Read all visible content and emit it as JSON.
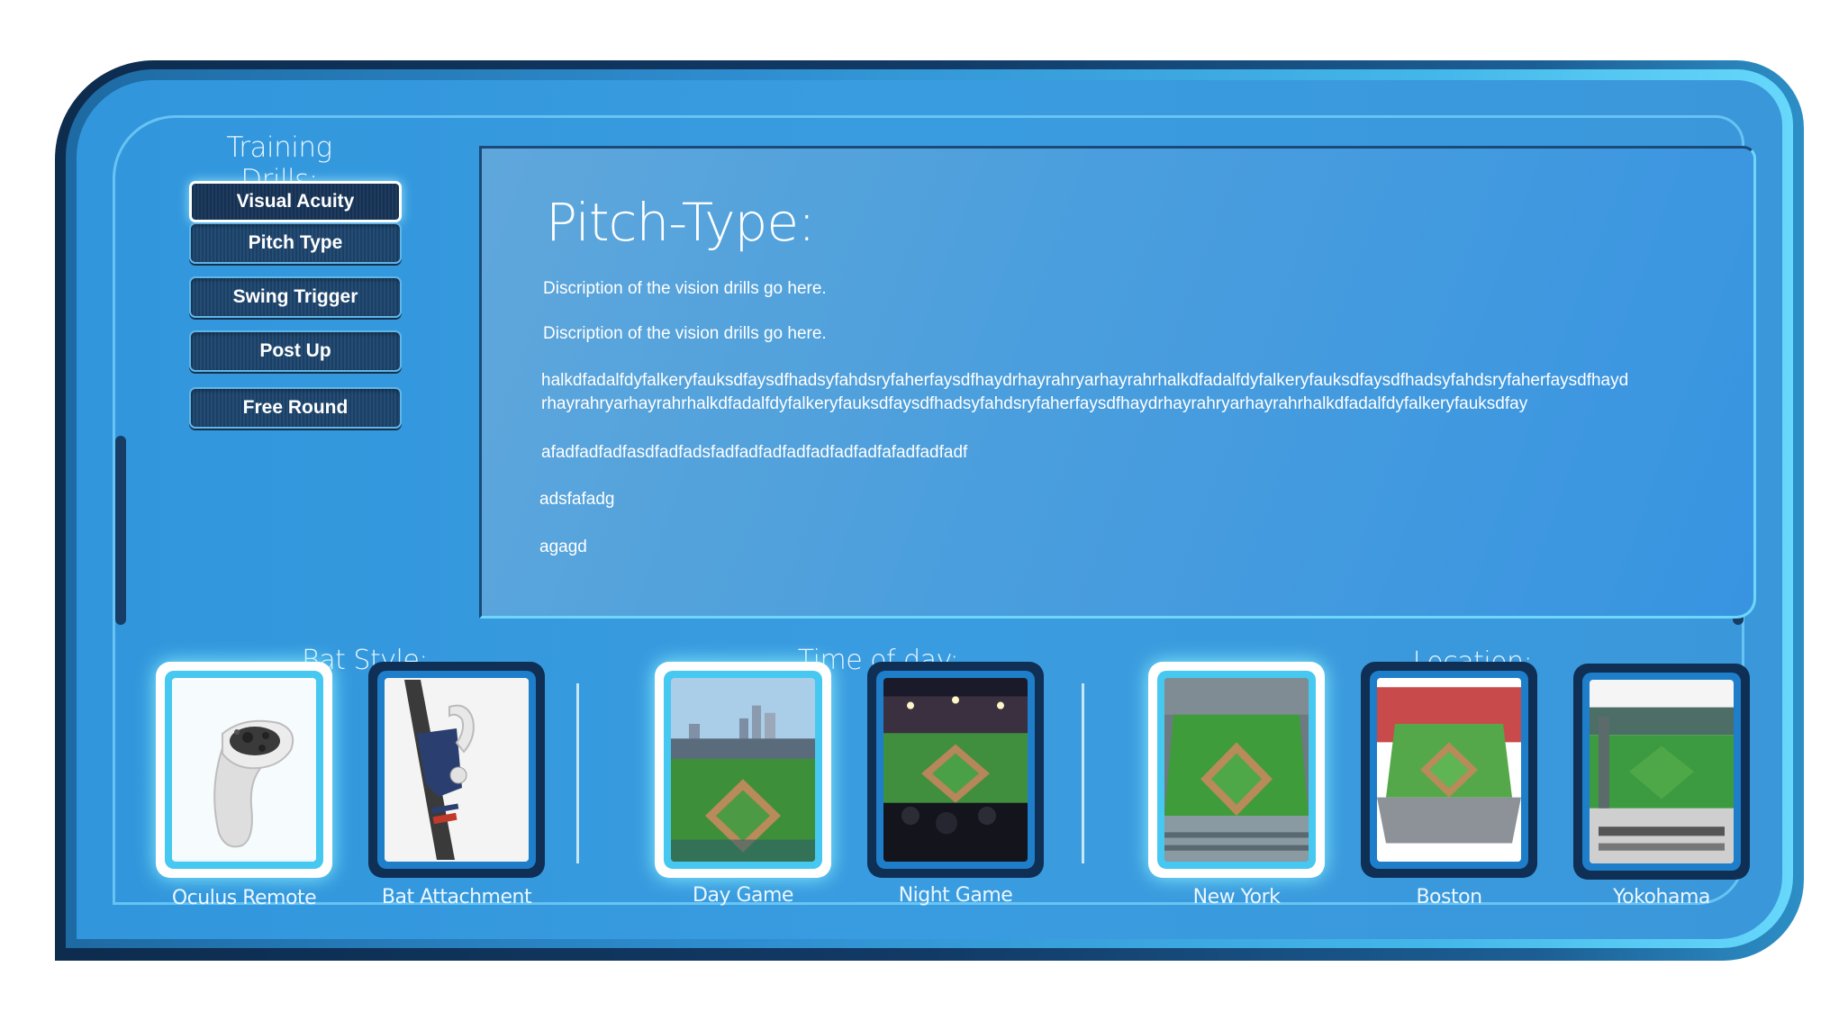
{
  "drills": {
    "title": "Training Drills:",
    "items": [
      {
        "label": "Visual Acuity",
        "active": true
      },
      {
        "label": "Pitch Type",
        "active": false
      },
      {
        "label": "Swing Trigger",
        "active": false
      },
      {
        "label": "Post Up",
        "active": false
      },
      {
        "label": "Free Round",
        "active": false
      }
    ]
  },
  "panel": {
    "title": "Pitch-Type:",
    "lines": [
      "Discription of the vision drills go here.",
      "Discription of the vision drills go here.",
      "halkdfadalfdyfalkeryfauksdfaysdfhadsyfahdsryfaherfaysdfhaydrhayrahryarhayrahrhalkdfadalfdyfalkeryfauksdfaysdfhadsyfahdsryfaherfaysdfhayd",
      "rhayrahryarhayrahrhalkdfadalfdyfalkeryfauksdfaysdfhadsyfahdsryfaherfaysdfhaydrhayrahryarhayrahrhalkdfadalfdyfalkeryfauksdfay",
      "afadfadfadfasdfadfadsfadfadfadfadfadfadfadfafadfadfadf",
      "adsfafadg",
      "agagd"
    ]
  },
  "bat_style": {
    "title": "Bat Style:",
    "options": [
      {
        "label": "Oculus Remote",
        "image": "oculus-controller",
        "selected": true
      },
      {
        "label": "Bat Attachment",
        "image": "bat-attachment",
        "selected": false
      }
    ]
  },
  "time_of_day": {
    "title": "Time of day:",
    "options": [
      {
        "label": "Day Game",
        "image": "day-stadium",
        "selected": true
      },
      {
        "label": "Night Game",
        "image": "night-stadium",
        "selected": false
      }
    ]
  },
  "location": {
    "title": "Location:",
    "options": [
      {
        "label": "New York",
        "image": "new-york-stadium",
        "selected": true
      },
      {
        "label": "Boston",
        "image": "boston-stadium",
        "selected": false
      },
      {
        "label": "Yokohama",
        "image": "yokohama-stadium",
        "selected": false
      }
    ]
  },
  "colors": {
    "frame_dark": "#0d2c4e",
    "panel_blue": "#3a9ce0",
    "accent_cyan": "#6ed7fb",
    "button_navy": "#1c3f63"
  }
}
